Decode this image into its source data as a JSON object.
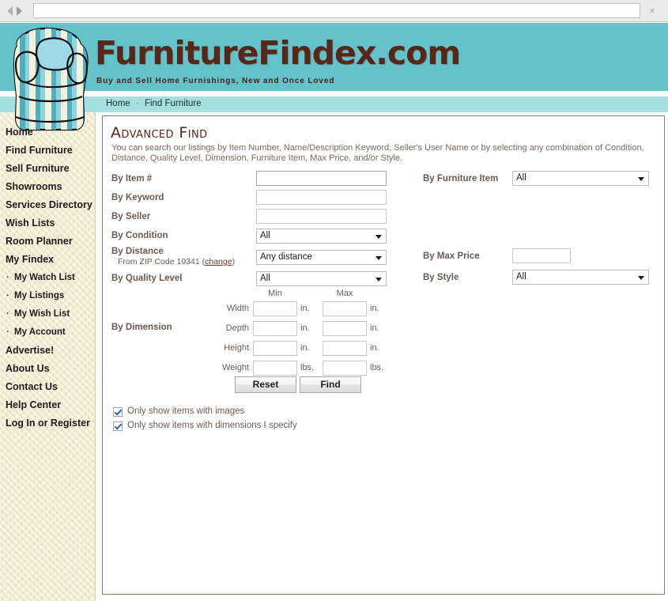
{
  "browser": {
    "url_value": "",
    "url_placeholder": "",
    "back_icon": "back-arrow-icon",
    "forward_icon": "forward-arrow-icon",
    "close_label": "×"
  },
  "header": {
    "wordmark": "FurnitureFindex.com",
    "tagline": "Buy and Sell Home Furnishings, New and Once Loved",
    "teal": "#63c2ca",
    "brand_brown": "#5a2618"
  },
  "breadcrumb": {
    "items": [
      "Home",
      "Find Furniture"
    ],
    "separator": "·"
  },
  "sidebar": {
    "items": [
      {
        "label": "Home",
        "sub": false
      },
      {
        "label": "Find Furniture",
        "sub": false
      },
      {
        "label": "Sell Furniture",
        "sub": false
      },
      {
        "label": "Showrooms",
        "sub": false
      },
      {
        "label": "Services Directory",
        "sub": false
      },
      {
        "label": "Wish Lists",
        "sub": false
      },
      {
        "label": "Room Planner",
        "sub": false
      },
      {
        "label": "My Findex",
        "sub": false
      },
      {
        "label": "My Watch List",
        "sub": true
      },
      {
        "label": "My Listings",
        "sub": true
      },
      {
        "label": "My Wish List",
        "sub": true
      },
      {
        "label": "My Account",
        "sub": true
      },
      {
        "label": "Advertise!",
        "sub": false
      },
      {
        "label": "About Us",
        "sub": false
      },
      {
        "label": "Contact Us",
        "sub": false
      },
      {
        "label": "Help Center",
        "sub": false
      },
      {
        "label": "Log In or Register",
        "sub": false
      }
    ]
  },
  "main": {
    "title": "Advanced Find",
    "intro": "You can search our listings by Item Number, Name/Description Keyword, Seller's User Name or by selecting any combination of Condition, Distance, Quality Level, Dimension, Furniture Item, Max Price, and/or Style."
  },
  "form": {
    "item_number": {
      "label": "By Item #",
      "value": "",
      "placeholder": ""
    },
    "keyword": {
      "label": "By Keyword",
      "value": "",
      "placeholder": ""
    },
    "seller": {
      "label": "By Seller",
      "value": "",
      "placeholder": ""
    },
    "condition": {
      "label": "By Condition",
      "value": "All"
    },
    "distance": {
      "label": "By Distance",
      "zip_prefix": "From ZIP Code",
      "zip": "19341",
      "change_link": "change",
      "value": "Any distance"
    },
    "quality_level": {
      "label": "By Quality Level",
      "value": "All"
    },
    "furniture_item": {
      "label": "By Furniture Item",
      "value": "All"
    },
    "max_price": {
      "label": "By Max Price",
      "value": "",
      "placeholder": ""
    },
    "style": {
      "label": "By Style",
      "value": "All"
    },
    "dimension": {
      "label": "By Dimension",
      "col_min": "Min",
      "col_max": "Max",
      "rows": [
        {
          "label": "Width",
          "min": "",
          "max": "",
          "unit": "in."
        },
        {
          "label": "Depth",
          "min": "",
          "max": "",
          "unit": "in."
        },
        {
          "label": "Height",
          "min": "",
          "max": "",
          "unit": "in."
        },
        {
          "label": "Weight",
          "min": "",
          "max": "",
          "unit": "lbs."
        }
      ]
    },
    "buttons": {
      "reset": "Reset",
      "find": "Find"
    },
    "checkboxes": [
      {
        "label": "Only show items with images",
        "checked": true
      },
      {
        "label": "Only show items with dimensions I specify",
        "checked": true
      }
    ]
  }
}
